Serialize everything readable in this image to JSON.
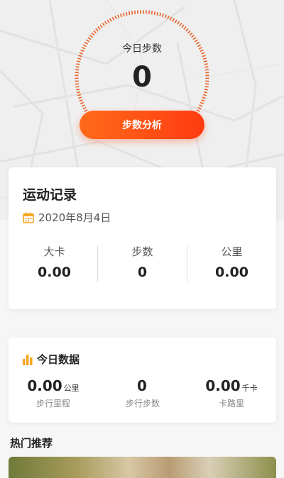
{
  "today": {
    "label": "今日步数",
    "value": "0",
    "button_label": "步数分析"
  },
  "record": {
    "title": "运动记录",
    "date": "2020年8月4日",
    "stats": [
      {
        "label": "大卡",
        "value": "0.00"
      },
      {
        "label": "步数",
        "value": "0"
      },
      {
        "label": "公里",
        "value": "0.00"
      }
    ]
  },
  "today_data": {
    "title": "今日数据",
    "items": [
      {
        "value": "0.00",
        "unit": "公里",
        "label": "步行里程"
      },
      {
        "value": "0",
        "unit": "",
        "label": "步行步数"
      },
      {
        "value": "0.00",
        "unit": "千卡",
        "label": "卡路里"
      }
    ]
  },
  "hot": {
    "title": "热门推荐"
  },
  "colors": {
    "accent": "#ff4f14",
    "ring": "#e8632a",
    "calendar": "#f5a623"
  }
}
